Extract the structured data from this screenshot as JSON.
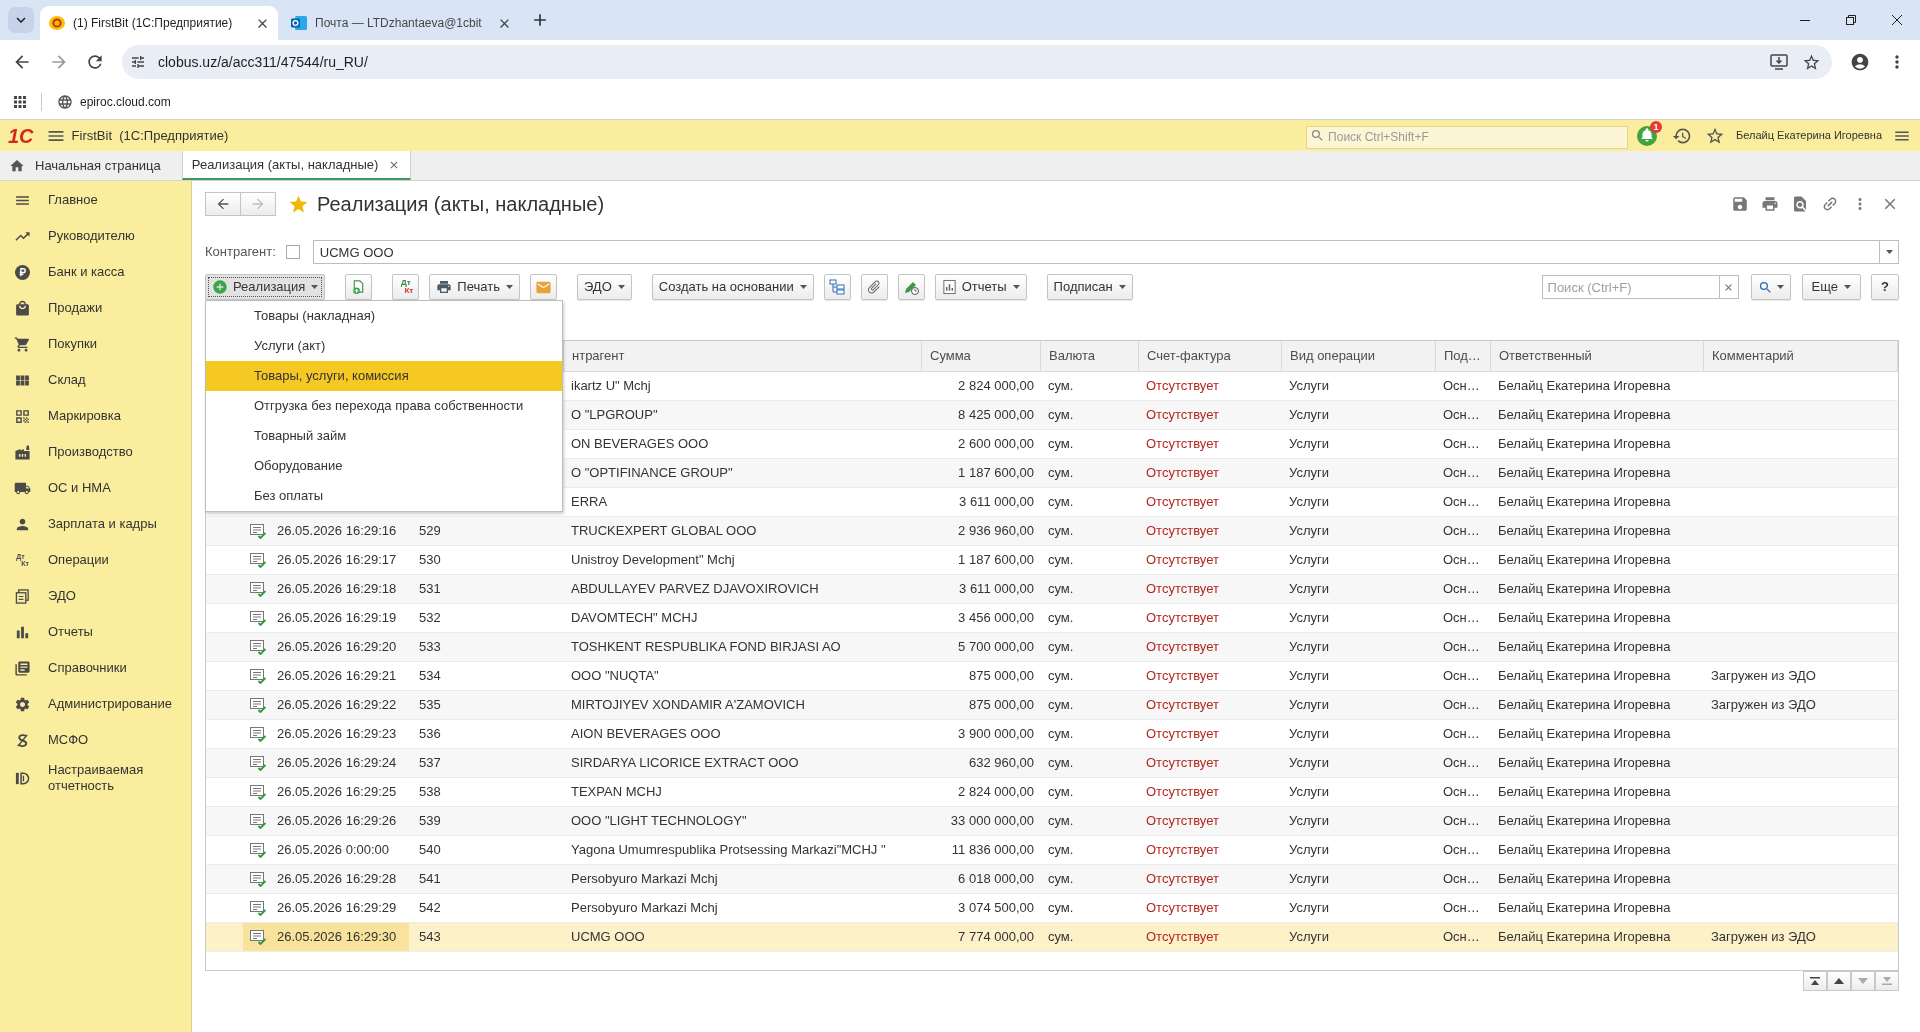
{
  "browser": {
    "tabs": [
      {
        "title": "(1) FirstBit (1С:Предприятие)",
        "kind": "app",
        "selected": true
      },
      {
        "title": "Почта — LTDzhantaeva@1cbit",
        "kind": "mail",
        "selected": false
      }
    ],
    "address": "clobus.uz/a/acc311/47544/ru_RU/",
    "bookmarks": [
      "epiroc.cloud.com"
    ]
  },
  "app_header": {
    "logo": "1С",
    "title": "FirstBit  (1С:Предприятие)",
    "search": {
      "placeholder": "Поиск Ctrl+Shift+F"
    },
    "notifications": "1",
    "user": "Белайц Екатерина Игоревна"
  },
  "open_tabs": [
    {
      "label": "Начальная страница",
      "kind": "home",
      "selected": false
    },
    {
      "label": "Реализация (акты, накладные)",
      "kind": "form",
      "selected": true
    }
  ],
  "sidebar": {
    "items": [
      {
        "label": "Главное",
        "kind": "main"
      },
      {
        "label": "Руководителю",
        "kind": "manager"
      },
      {
        "label": "Банк и касса",
        "kind": "bank"
      },
      {
        "label": "Продажи",
        "kind": "sales"
      },
      {
        "label": "Покупки",
        "kind": "purchases"
      },
      {
        "label": "Склад",
        "kind": "warehouse"
      },
      {
        "label": "Маркировка",
        "kind": "marking"
      },
      {
        "label": "Производство",
        "kind": "production"
      },
      {
        "label": "ОС и НМА",
        "kind": "assets"
      },
      {
        "label": "Зарплата и кадры",
        "kind": "salary"
      },
      {
        "label": "Операции",
        "kind": "operations",
        "icon_text": [
          "Дт",
          "Кт"
        ]
      },
      {
        "label": "ЭДО",
        "kind": "edo"
      },
      {
        "label": "Отчеты",
        "kind": "reports"
      },
      {
        "label": "Справочники",
        "kind": "directories"
      },
      {
        "label": "Администрирование",
        "kind": "admin"
      },
      {
        "label": "МСФО",
        "kind": "ifrs"
      },
      {
        "label": "Настраиваемая отчетность",
        "kind": "custom_reports"
      }
    ]
  },
  "form": {
    "title": "Реализация (акты, накладные)",
    "favorite": true,
    "filter": {
      "label": "Контрагент:",
      "checked": false,
      "value": "UCMG OOO"
    },
    "toolbar": [
      [
        {
          "kind": "create",
          "label": "Реализация",
          "caret": true,
          "open": true,
          "menu": [
            {
              "label": "Товары (накладная)",
              "selected": false
            },
            {
              "label": "Услуги (акт)",
              "selected": false
            },
            {
              "label": "Товары, услуги, комиссия",
              "selected": true
            },
            {
              "label": "Отгрузка без перехода права собственности",
              "selected": false
            },
            {
              "label": "Товарный займ",
              "selected": false
            },
            {
              "label": "Оборудование",
              "selected": false
            },
            {
              "label": "Без оплаты",
              "selected": false
            }
          ]
        }
      ],
      [
        {
          "kind": "copy"
        }
      ],
      [
        {
          "kind": "entries",
          "icon_text": [
            "Дт",
            "Кт"
          ]
        },
        {
          "kind": "print",
          "label": "Печать",
          "caret": true
        },
        {
          "kind": "email"
        }
      ],
      [
        {
          "kind": "plain",
          "label": "ЭДО",
          "caret": true
        }
      ],
      [
        {
          "kind": "plain",
          "label": "Создать на основании",
          "caret": true
        },
        {
          "kind": "structure"
        },
        {
          "kind": "attach"
        },
        {
          "kind": "sign"
        },
        {
          "kind": "reports",
          "label": "Отчеты",
          "caret": true
        }
      ],
      [
        {
          "kind": "plain",
          "label": "Подписан",
          "caret": true
        }
      ]
    ],
    "search": {
      "placeholder": "Поиск (Ctrl+F)"
    },
    "search_button": {
      "caret": true
    },
    "more": {
      "label": "Еще",
      "caret": true
    },
    "help": {
      "label": "?"
    },
    "table": {
      "columns": [
        "нтрагент",
        "Сумма",
        "Валюта",
        "Счет-фактура",
        "Вид операции",
        "Под…",
        "Ответственный",
        "Комментарий"
      ],
      "rows": [
        {
          "cells": [
            "ikartz U\" Mchj",
            "2 824 000,00",
            "сум.",
            "Отсутствует",
            "Услуги",
            "Осн…",
            "Белайц Екатерина Игоревна"
          ],
          "selected": false
        },
        {
          "cells": [
            "O \"LPGROUP\"",
            "8 425 000,00",
            "сум.",
            "Отсутствует",
            "Услуги",
            "Осн…",
            "Белайц Екатерина Игоревна"
          ],
          "selected": false
        },
        {
          "cells": [
            "ON BEVERAGES OOO",
            "2 600 000,00",
            "сум.",
            "Отсутствует",
            "Услуги",
            "Осн…",
            "Белайц Екатерина Игоревна"
          ],
          "selected": false
        },
        {
          "cells": [
            "O \"OPTIFINANCE GROUP\"",
            "1 187 600,00",
            "сум.",
            "Отсутствует",
            "Услуги",
            "Осн…",
            "Белайц Екатерина Игоревна"
          ],
          "selected": false
        },
        {
          "cells": [
            "ERRA",
            "3 611 000,00",
            "сум.",
            "Отсутствует",
            "Услуги",
            "Осн…",
            "Белайц Екатерина Игоревна"
          ],
          "selected": false
        },
        {
          "posted": true,
          "date": "26.05.2026 16:29:16",
          "number": "529",
          "cells": [
            "TRUCKEXPERT GLOBAL OOO",
            "2 936 960,00",
            "сум.",
            "Отсутствует",
            "Услуги",
            "Осн…",
            "Белайц Екатерина Игоревна"
          ],
          "selected": false
        },
        {
          "posted": true,
          "date": "26.05.2026 16:29:17",
          "number": "530",
          "cells": [
            "Unistroy Development\" Mchj",
            "1 187 600,00",
            "сум.",
            "Отсутствует",
            "Услуги",
            "Осн…",
            "Белайц Екатерина Игоревна"
          ],
          "selected": false
        },
        {
          "posted": true,
          "date": "26.05.2026 16:29:18",
          "number": "531",
          "cells": [
            "ABDULLAYEV PARVEZ DJAVOXIROVICH",
            "3 611 000,00",
            "сум.",
            "Отсутствует",
            "Услуги",
            "Осн…",
            "Белайц Екатерина Игоревна"
          ],
          "selected": false
        },
        {
          "posted": true,
          "date": "26.05.2026 16:29:19",
          "number": "532",
          "cells": [
            "DAVOMTECH\" MCHJ",
            "3 456 000,00",
            "сум.",
            "Отсутствует",
            "Услуги",
            "Осн…",
            "Белайц Екатерина Игоревна"
          ],
          "selected": false
        },
        {
          "posted": true,
          "date": "26.05.2026 16:29:20",
          "number": "533",
          "cells": [
            "TOSHKENT RESPUBLIKA FOND BIRJASI AO",
            "5 700 000,00",
            "сум.",
            "Отсутствует",
            "Услуги",
            "Осн…",
            "Белайц Екатерина Игоревна"
          ],
          "selected": false
        },
        {
          "posted": true,
          "date": "26.05.2026 16:29:21",
          "number": "534",
          "cells": [
            "OOO \"NUQTA\"",
            "875 000,00",
            "сум.",
            "Отсутствует",
            "Услуги",
            "Осн…",
            "Белайц Екатерина Игоревна",
            "Загружен из ЭДО"
          ],
          "selected": false
        },
        {
          "posted": true,
          "date": "26.05.2026 16:29:22",
          "number": "535",
          "cells": [
            "MIRTOJIYEV XONDAMIR A'ZAMOVICH",
            "875 000,00",
            "сум.",
            "Отсутствует",
            "Услуги",
            "Осн…",
            "Белайц Екатерина Игоревна",
            "Загружен из ЭДО"
          ],
          "selected": false
        },
        {
          "posted": true,
          "date": "26.05.2026 16:29:23",
          "number": "536",
          "cells": [
            "AION BEVERAGES OOO",
            "3 900 000,00",
            "сум.",
            "Отсутствует",
            "Услуги",
            "Осн…",
            "Белайц Екатерина Игоревна"
          ],
          "selected": false
        },
        {
          "posted": true,
          "date": "26.05.2026 16:29:24",
          "number": "537",
          "cells": [
            "SIRDARYA LICORICE EXTRACT OOO",
            "632 960,00",
            "сум.",
            "Отсутствует",
            "Услуги",
            "Осн…",
            "Белайц Екатерина Игоревна"
          ],
          "selected": false
        },
        {
          "posted": true,
          "date": "26.05.2026 16:29:25",
          "number": "538",
          "cells": [
            "TEXPAN MCHJ",
            "2 824 000,00",
            "сум.",
            "Отсутствует",
            "Услуги",
            "Осн…",
            "Белайц Екатерина Игоревна"
          ],
          "selected": false
        },
        {
          "posted": true,
          "date": "26.05.2026 16:29:26",
          "number": "539",
          "cells": [
            "OOO \"LIGHT TECHNOLOGY\"",
            "33 000 000,00",
            "сум.",
            "Отсутствует",
            "Услуги",
            "Осн…",
            "Белайц Екатерина Игоревна"
          ],
          "selected": false
        },
        {
          "posted": true,
          "date": "26.05.2026 0:00:00",
          "number": "540",
          "cells": [
            "Yagona Umumrespublika Protsessing Markazi\"MCHJ \"",
            "11 836 000,00",
            "сум.",
            "Отсутствует",
            "Услуги",
            "Осн…",
            "Белайц Екатерина Игоревна"
          ],
          "selected": false
        },
        {
          "posted": true,
          "date": "26.05.2026 16:29:28",
          "number": "541",
          "cells": [
            "Persobyuro Markazi Mchj",
            "6 018 000,00",
            "сум.",
            "Отсутствует",
            "Услуги",
            "Осн…",
            "Белайц Екатерина Игоревна"
          ],
          "selected": false
        },
        {
          "posted": true,
          "date": "26.05.2026 16:29:29",
          "number": "542",
          "cells": [
            "Persobyuro Markazi Mchj",
            "3 074 500,00",
            "сум.",
            "Отсутствует",
            "Услуги",
            "Осн…",
            "Белайц Екатерина Игоревна"
          ],
          "selected": false
        },
        {
          "posted": true,
          "date": "26.05.2026 16:29:30",
          "number": "543",
          "cells": [
            "UCMG OOO",
            "7 774 000,00",
            "сум.",
            "Отсутствует",
            "Услуги",
            "Осн…",
            "Белайц Екатерина Игоревна",
            "Загружен из ЭДО"
          ],
          "selected": true
        }
      ]
    }
  }
}
